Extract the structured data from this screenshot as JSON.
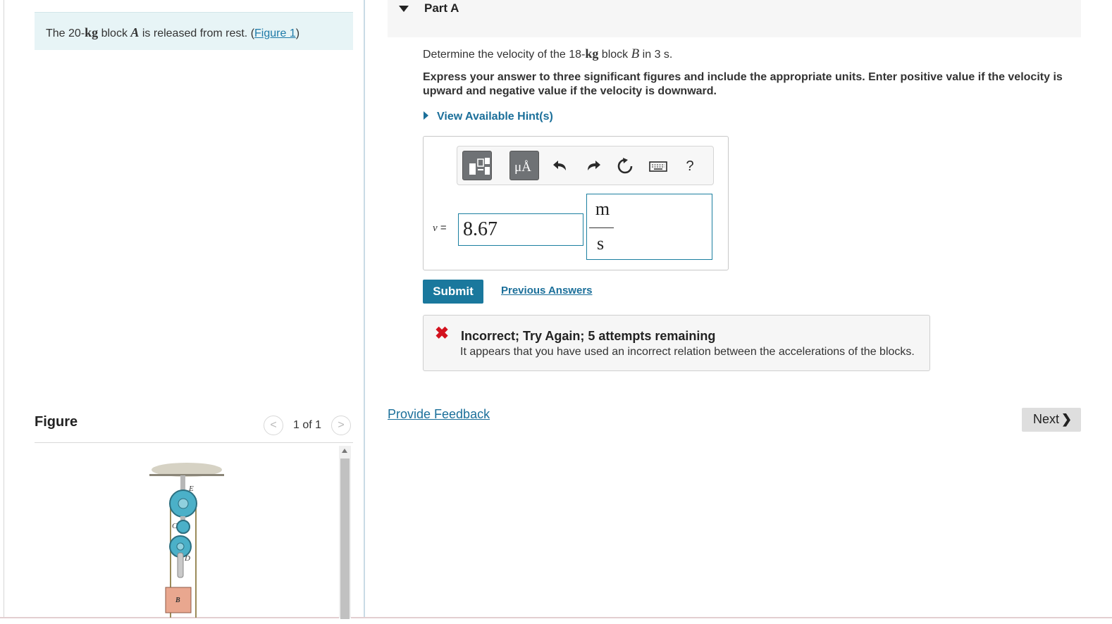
{
  "problem": {
    "pre": "The 20-",
    "unit": "kg",
    "mid": " block ",
    "var": "A",
    "post": " is released from rest. (",
    "figure_link": "Figure 1",
    "close": ")"
  },
  "figure": {
    "title": "Figure",
    "count": "1 of 1",
    "prev": "<",
    "next": ">",
    "labels": {
      "e": "E",
      "c": "C",
      "d": "D",
      "b": "B"
    }
  },
  "part": {
    "title": "Part A"
  },
  "question": {
    "pre": "Determine the velocity of the 18-",
    "unit": "kg",
    "mid": " block ",
    "var": "B",
    "post": " in 3 s."
  },
  "instructions": "Express your answer to three significant figures and include the appropriate units. Enter positive value if the velocity is upward and negative value if the velocity is downward.",
  "hint_link": "View Available Hint(s)",
  "toolbar": {
    "units_label": "μÅ",
    "help": "?",
    "icons": [
      "templates-icon",
      "units-icon",
      "undo-icon",
      "redo-icon",
      "reset-icon",
      "keyboard-icon",
      "help-icon"
    ]
  },
  "answer": {
    "variable": "v",
    "equals": " =",
    "value": "8.67",
    "unit_num": "m",
    "unit_den": "s"
  },
  "buttons": {
    "submit": "Submit",
    "previous_answers": "Previous Answers",
    "next": "Next",
    "next_chevron": "❯"
  },
  "feedback": {
    "mark": "✖",
    "title": "Incorrect; Try Again; 5 attempts remaining",
    "text": "It appears that you have used an incorrect relation between the accelerations of the blocks."
  },
  "provide_feedback": "Provide Feedback",
  "colors": {
    "accent": "#1a789d",
    "link": "#1b6f9a",
    "error": "#d3121e",
    "problem_bg": "#e7f4f6"
  }
}
